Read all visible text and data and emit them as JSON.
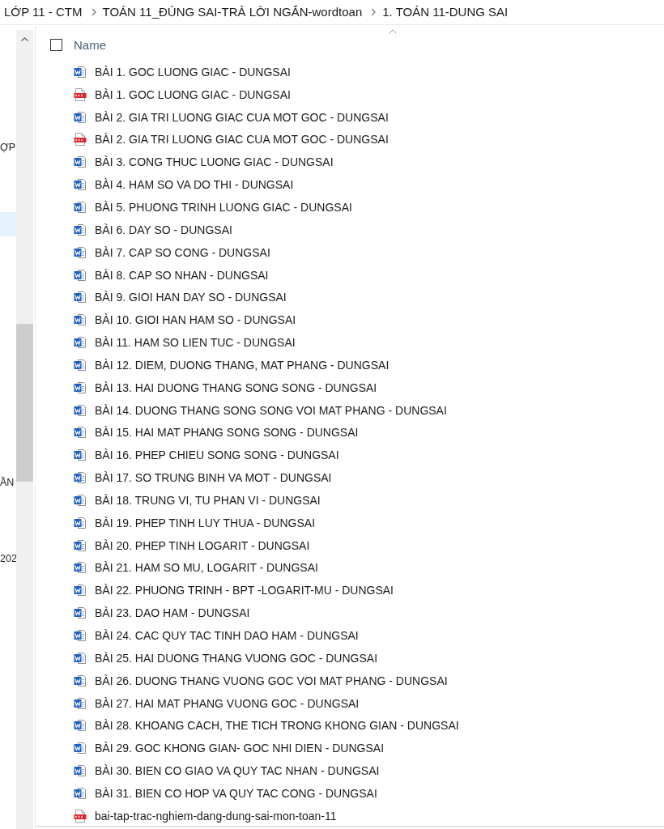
{
  "breadcrumb": {
    "items": [
      {
        "label": "LỚP 11 - CTM"
      },
      {
        "label": "TOÁN 11_ĐÚNG SAI-TRẢ LỜI NGẮN-wordtoan"
      },
      {
        "label": "1. TOÁN 11-DUNG SAI"
      }
    ]
  },
  "nav_pane": {
    "items": [
      {
        "label": "ỢP",
        "selected": false
      },
      {
        "selected": true
      },
      {
        "label": "ẦN",
        "selected": false
      },
      {
        "label": "202",
        "selected": false
      }
    ]
  },
  "file_list": {
    "select_all": {
      "checked": false
    },
    "columns": [
      {
        "label": "Name",
        "sorted": true
      }
    ],
    "rows": [
      {
        "name": "BÀI 1. GOC LUONG GIAC - DUNGSAI",
        "kind": "word"
      },
      {
        "name": "BÀI 1. GOC LUONG GIAC - DUNGSAI",
        "kind": "pdf"
      },
      {
        "name": "BÀI 2. GIA TRI LUONG GIAC CUA MOT GOC - DUNGSAI",
        "kind": "word"
      },
      {
        "name": "BÀI 2. GIA TRI LUONG GIAC CUA MOT GOC - DUNGSAI",
        "kind": "pdf"
      },
      {
        "name": "BÀI 3. CONG THUC LUONG GIAC - DUNGSAI",
        "kind": "word"
      },
      {
        "name": "BÀI 4. HAM SO VA DO THI - DUNGSAI",
        "kind": "word"
      },
      {
        "name": "BÀI 5. PHUONG TRINH LUONG GIAC - DUNGSAI",
        "kind": "word"
      },
      {
        "name": "BÀI 6. DAY SO - DUNGSAI",
        "kind": "word"
      },
      {
        "name": "BÀI 7. CAP SO CONG - DUNGSAI",
        "kind": "word"
      },
      {
        "name": "BÀI 8. CAP SO NHAN - DUNGSAI",
        "kind": "word"
      },
      {
        "name": "BÀI 9. GIOI HAN DAY SO - DUNGSAI",
        "kind": "word"
      },
      {
        "name": "BÀI 10. GIOI HAN HAM SO - DUNGSAI",
        "kind": "word"
      },
      {
        "name": "BÀI 11. HAM SO LIEN TUC - DUNGSAI",
        "kind": "word"
      },
      {
        "name": "BÀI 12. DIEM, DUONG THANG, MAT PHANG - DUNGSAI",
        "kind": "word"
      },
      {
        "name": "BÀI 13. HAI DUONG THANG SONG SONG - DUNGSAI",
        "kind": "word"
      },
      {
        "name": "BÀI 14. DUONG THANG SONG SONG VOI MAT PHANG - DUNGSAI",
        "kind": "word"
      },
      {
        "name": "BÀI 15. HAI MAT PHANG SONG SONG - DUNGSAI",
        "kind": "word"
      },
      {
        "name": "BÀI 16. PHEP CHIEU SONG SONG - DUNGSAI",
        "kind": "word"
      },
      {
        "name": "BÀI 17. SO TRUNG BINH VA MOT - DUNGSAI",
        "kind": "word"
      },
      {
        "name": "BÀI 18. TRUNG VI, TU PHAN VI - DUNGSAI",
        "kind": "word"
      },
      {
        "name": "BÀI 19. PHEP TINH LUY THUA - DUNGSAI",
        "kind": "word"
      },
      {
        "name": "BÀI 20. PHEP TINH LOGARIT - DUNGSAI",
        "kind": "word"
      },
      {
        "name": "BÀI 21. HAM SO MU, LOGARIT - DUNGSAI",
        "kind": "word"
      },
      {
        "name": "BÀI 22. PHUONG TRINH - BPT -LOGARIT-MU - DUNGSAI",
        "kind": "word"
      },
      {
        "name": "BÀI 23. DAO HAM - DUNGSAI",
        "kind": "word"
      },
      {
        "name": "BÀI 24. CAC QUY TAC TINH DAO HAM - DUNGSAI",
        "kind": "word"
      },
      {
        "name": "BÀI 25. HAI DUONG THANG VUONG GOC - DUNGSAI",
        "kind": "word"
      },
      {
        "name": "BÀI 26. DUONG THANG VUONG GOC VOI MAT PHANG - DUNGSAI",
        "kind": "word"
      },
      {
        "name": "BÀI 27. HAI MAT PHANG VUONG GOC - DUNGSAI",
        "kind": "word"
      },
      {
        "name": "BÀI 28. KHOANG CACH, THE TICH TRONG KHONG GIAN - DUNGSAI",
        "kind": "word"
      },
      {
        "name": "BÀI 29. GOC KHONG GIAN- GOC NHI DIEN - DUNGSAI",
        "kind": "word"
      },
      {
        "name": "BÀI 30. BIEN CO GIAO VA QUY TAC NHAN - DUNGSAI",
        "kind": "word"
      },
      {
        "name": "BÀI 31. BIEN CO HOP VA QUY TAC CONG - DUNGSAI",
        "kind": "word"
      },
      {
        "name": "bai-tap-trac-nghiem-dang-dung-sai-mon-toan-11",
        "kind": "pdf"
      }
    ]
  }
}
